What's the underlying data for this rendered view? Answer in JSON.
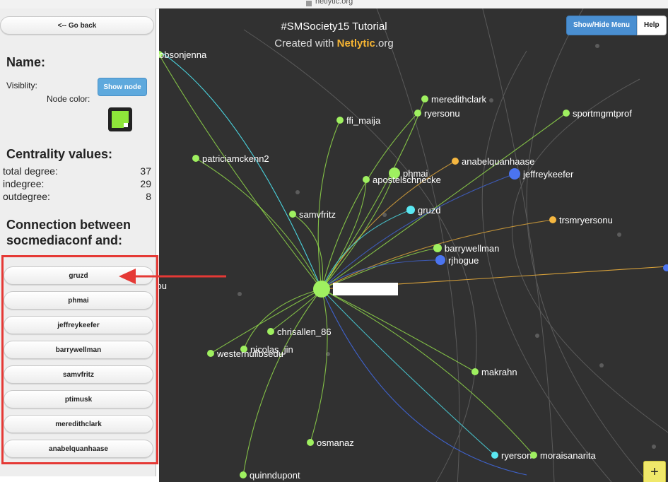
{
  "browser": {
    "title": "netlytic.org"
  },
  "sidebar": {
    "go_back": "<-- Go back",
    "name_heading": "Name:",
    "visibility_label": "Visiblity:",
    "show_node": "Show node",
    "node_color_label": "Node color:",
    "node_color_value": "#8ee63a",
    "centrality_heading": "Centrality values:",
    "centrality": [
      {
        "label": "total degree:",
        "value": "37"
      },
      {
        "label": "indegree:",
        "value": "29"
      },
      {
        "label": "outdegree:",
        "value": "8"
      }
    ],
    "connection_heading_1": "Connection between",
    "connection_heading_2": "socmediaconf and:",
    "connections": [
      "gruzd",
      "phmai",
      "jeffreykeefer",
      "barrywellman",
      "samvfritz",
      "ptimusk",
      "meredithclark",
      "anabelquanhaase"
    ]
  },
  "canvas": {
    "title": "#SMSociety15 Tutorial",
    "subtitle_prefix": "Created with ",
    "subtitle_brand": "Netlytic",
    "subtitle_suffix": ".org",
    "show_hide_menu": "Show/Hide Menu",
    "help": "Help",
    "zoom_in": "+",
    "nodes": [
      {
        "label": "obsonjenna",
        "color": "#9ff060"
      },
      {
        "label": "meredithclark",
        "color": "#9ff060"
      },
      {
        "label": "ryersonu",
        "color": "#9ff060"
      },
      {
        "label": "sportmgmtprof",
        "color": "#9ff060"
      },
      {
        "label": "ffi_maija",
        "color": "#9ff060"
      },
      {
        "label": "patriciamckenn2",
        "color": "#9ff060"
      },
      {
        "label": "anabelquanhaase",
        "color": "#f5b740"
      },
      {
        "label": "phmai",
        "color": "#9ff060"
      },
      {
        "label": "jeffreykeefer",
        "color": "#4b74f0"
      },
      {
        "label": "apostelschnecke",
        "color": "#9ff060"
      },
      {
        "label": "gruzd",
        "color": "#5ae8f2"
      },
      {
        "label": "samvfritz",
        "color": "#9ff060"
      },
      {
        "label": "trsmryersonu",
        "color": "#f5b740"
      },
      {
        "label": "barrywellman",
        "color": "#9ff060"
      },
      {
        "label": "rjhogue",
        "color": "#4b74f0"
      },
      {
        "label": "sou",
        "color": "#9ff060"
      },
      {
        "label": "socmediaconf",
        "color": "#9ff060"
      },
      {
        "label": "chrisallen_86",
        "color": "#9ff060"
      },
      {
        "label": "nicolas_jin",
        "color": "#9ff060"
      },
      {
        "label": "westernulibsedu",
        "color": "#9ff060"
      },
      {
        "label": "makrahn",
        "color": "#9ff060"
      },
      {
        "label": "osmanaz",
        "color": "#9ff060"
      },
      {
        "label": "ryerson",
        "color": "#5ae8f2"
      },
      {
        "label": "moraisanarita",
        "color": "#9ff060"
      },
      {
        "label": "quinndupont",
        "color": "#9ff060"
      }
    ]
  }
}
